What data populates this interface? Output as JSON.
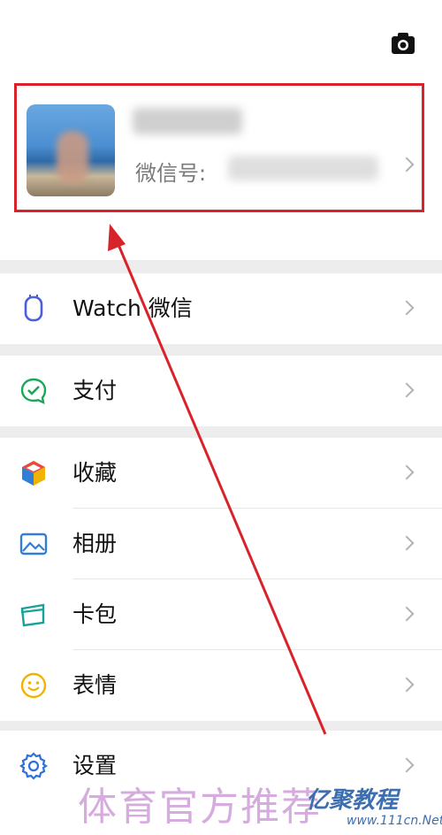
{
  "profile": {
    "wechat_id_label": "微信号:"
  },
  "menu": {
    "watch": {
      "label": "Watch 微信"
    },
    "pay": {
      "label": "支付"
    },
    "favorites": {
      "label": "收藏"
    },
    "album": {
      "label": "相册"
    },
    "cards": {
      "label": "卡包"
    },
    "stickers": {
      "label": "表情"
    },
    "settings": {
      "label": "设置"
    }
  },
  "watermark": {
    "main_text": "体育官方推荐",
    "brand_text": "亿聚教程",
    "site_text": "www.111cn.Net"
  },
  "colors": {
    "highlight": "#d8232a",
    "arrow": "#d8232a",
    "watch_icon": "#4b5fd6",
    "pay_icon": "#19a75a",
    "favorites_icon_red": "#e84a3c",
    "album_icon": "#2f7fd8",
    "cards_icon": "#17a39a",
    "stickers_icon": "#f0b400",
    "settings_icon": "#2f6fd8"
  },
  "icons": {
    "camera": "camera-icon",
    "watch": "watch-icon",
    "pay": "pay-icon",
    "favorites": "cube-icon",
    "album": "image-icon",
    "cards": "card-icon",
    "stickers": "smile-icon",
    "settings": "gear-icon"
  }
}
